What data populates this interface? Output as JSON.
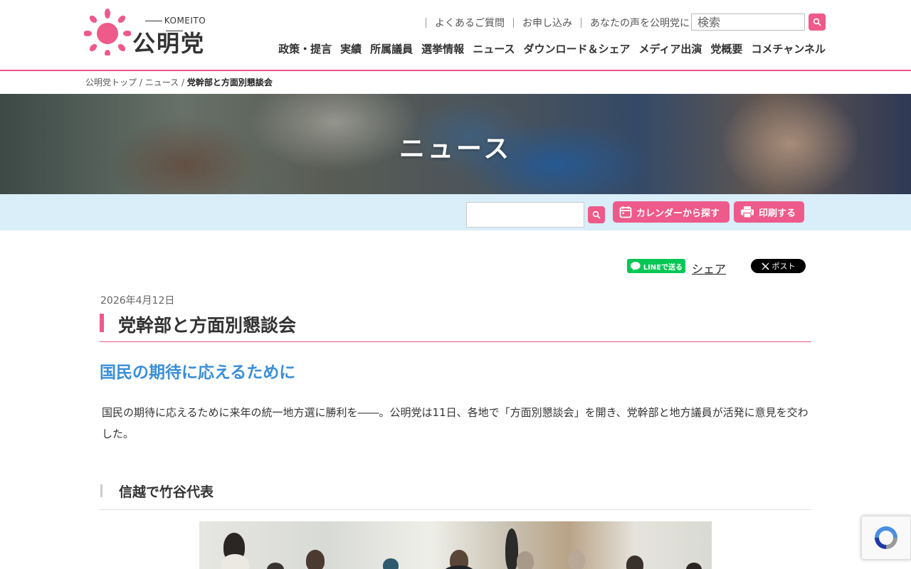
{
  "header": {
    "logo_sub": "KOMEITO",
    "logo_main": "公明党",
    "util_links": [
      "よくあるご質問",
      "お申し込み",
      "あなたの声を公明党に"
    ],
    "search_placeholder": "検索",
    "nav": [
      "政策・提言",
      "実績",
      "所属議員",
      "選挙情報",
      "ニュース",
      "ダウンロード＆シェア",
      "メディア出演",
      "党概要",
      "コメチャンネル"
    ]
  },
  "breadcrumb": {
    "home": "公明党トップ",
    "sep": "/",
    "section": "ニュース",
    "current": "党幹部と方面別懇談会"
  },
  "hero": {
    "title": "ニュース"
  },
  "toolbar": {
    "calendar_label": "カレンダーから探す",
    "print_label": "印刷する"
  },
  "share": {
    "line_label": "LINEで送る",
    "share_label": "シェア",
    "x_label": "ポスト"
  },
  "article": {
    "date": "2026年4月12日",
    "title": "党幹部と方面別懇談会",
    "subtitle": "国民の期待に応えるために",
    "lead": "国民の期待に応えるために来年の統一地方選に勝利を――。公明党は11日、各地で「方面別懇談会」を開き、党幹部と地方議員が活発に意見を交わした。",
    "section_title": "信越で竹谷代表"
  },
  "colors": {
    "accent": "#ee5a8a",
    "subtitle_blue": "#3a8fd8",
    "toolbar_bg": "#d9eef8",
    "line_green": "#06c755"
  },
  "icons": [
    "sun-logo-icon",
    "search-icon",
    "calendar-icon",
    "printer-icon",
    "line-icon",
    "x-logo-icon",
    "recaptcha-icon"
  ]
}
